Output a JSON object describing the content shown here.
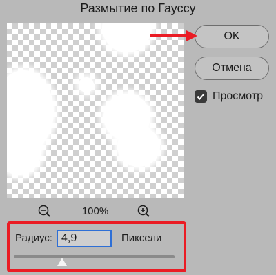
{
  "dialog": {
    "title": "Размытие по Гауссу"
  },
  "buttons": {
    "ok_label": "OK",
    "cancel_label": "Отмена"
  },
  "preview_toggle": {
    "label": "Просмотр",
    "checked": true
  },
  "zoom": {
    "level": "100%",
    "zoom_out_icon": "zoom-out-icon",
    "zoom_in_icon": "zoom-in-icon"
  },
  "radius": {
    "label": "Радиус:",
    "value": "4,9",
    "unit": "Пиксели",
    "slider_fraction": 0.3
  },
  "annotations": {
    "highlight_color": "#ea1c24",
    "arrow_color": "#ea1c24"
  }
}
